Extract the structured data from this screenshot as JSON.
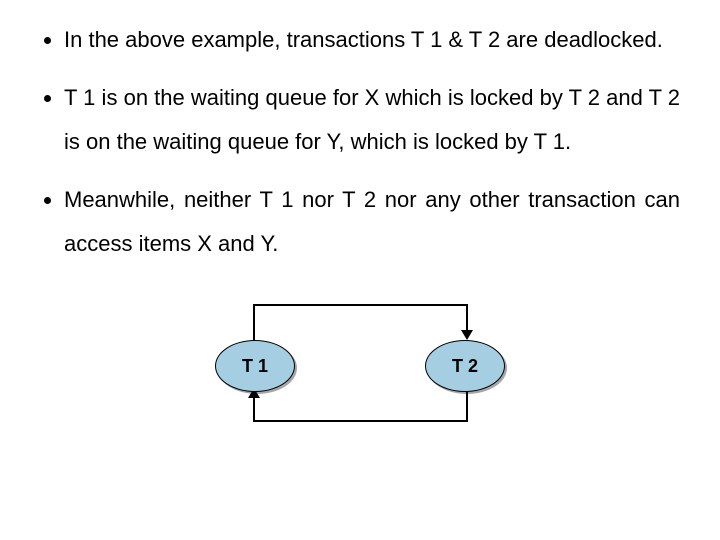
{
  "bullets": [
    "In the above example, transactions T 1 & T 2 are deadlocked.",
    "T 1 is on the waiting queue for X which is locked by T 2 and T 2 is on the waiting queue for Y, which is locked by T 1.",
    "Meanwhile, neither T 1 nor T 2 nor any other transaction can access items X and Y."
  ],
  "diagram": {
    "node1": "T 1",
    "node2": "T 2"
  }
}
